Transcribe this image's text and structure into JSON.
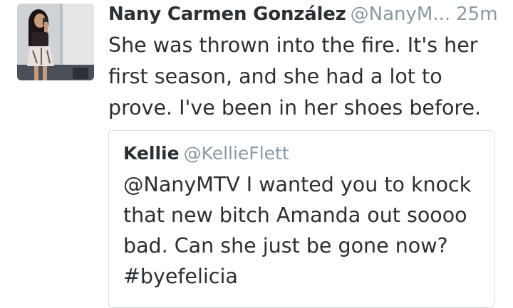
{
  "tweet": {
    "author_name": "Nany Carmen González",
    "author_handle": "@NanyM...",
    "timestamp": "25m",
    "text": "She was thrown into the fire. It's her first season, and she had a lot to prove. I've been in her shoes before.",
    "avatar_icon": "profile-photo"
  },
  "quoted_tweet": {
    "author_name": "Kellie",
    "author_handle": "@KellieFlett",
    "text": "@NanyMTV I wanted you to knock that new bitch Amanda out soooo bad. Can she just be gone now? #byefelicia"
  },
  "colors": {
    "primary_text": "#292f33",
    "secondary_text": "#8899a6",
    "border": "#d8dee3"
  }
}
